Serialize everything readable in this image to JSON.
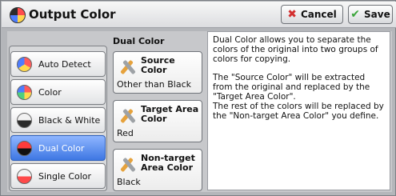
{
  "header": {
    "title": "Output Color",
    "cancel_label": "Cancel",
    "save_label": "Save",
    "cancel_icon": "x-icon",
    "save_icon": "check-icon"
  },
  "left_options": [
    {
      "label": "Auto Detect",
      "icon": "auto-detect-icon"
    },
    {
      "label": "Color",
      "icon": "color-icon"
    },
    {
      "label": "Black & White",
      "icon": "black-white-icon"
    },
    {
      "label": "Dual Color",
      "icon": "dual-color-icon",
      "selected": true
    },
    {
      "label": "Single Color",
      "icon": "single-color-icon"
    }
  ],
  "section": {
    "title": "Dual Color"
  },
  "tiles": [
    {
      "label": "Source Color",
      "value": "Other than Black",
      "icon": "edit-icon"
    },
    {
      "label": "Target Area Color",
      "value": "Red",
      "icon": "edit-icon"
    },
    {
      "label": "Non-target Area Color",
      "value": "Black",
      "icon": "edit-icon"
    }
  ],
  "description": {
    "paragraphs": [
      "Dual Color allows you to separate the colors of the original into two groups of colors for copying.",
      "The \"Source Color\" will be extracted from the original and replaced by the \"Target Area Color\".\nThe rest of the colors will be replaced by the \"Non-target Area Color\" you define."
    ]
  },
  "colors": {
    "selected_bg": "#3e77e3",
    "panel_bg": "#c7c8cb",
    "cancel_icon": "#d32f2f",
    "save_icon": "#3aa53a"
  }
}
